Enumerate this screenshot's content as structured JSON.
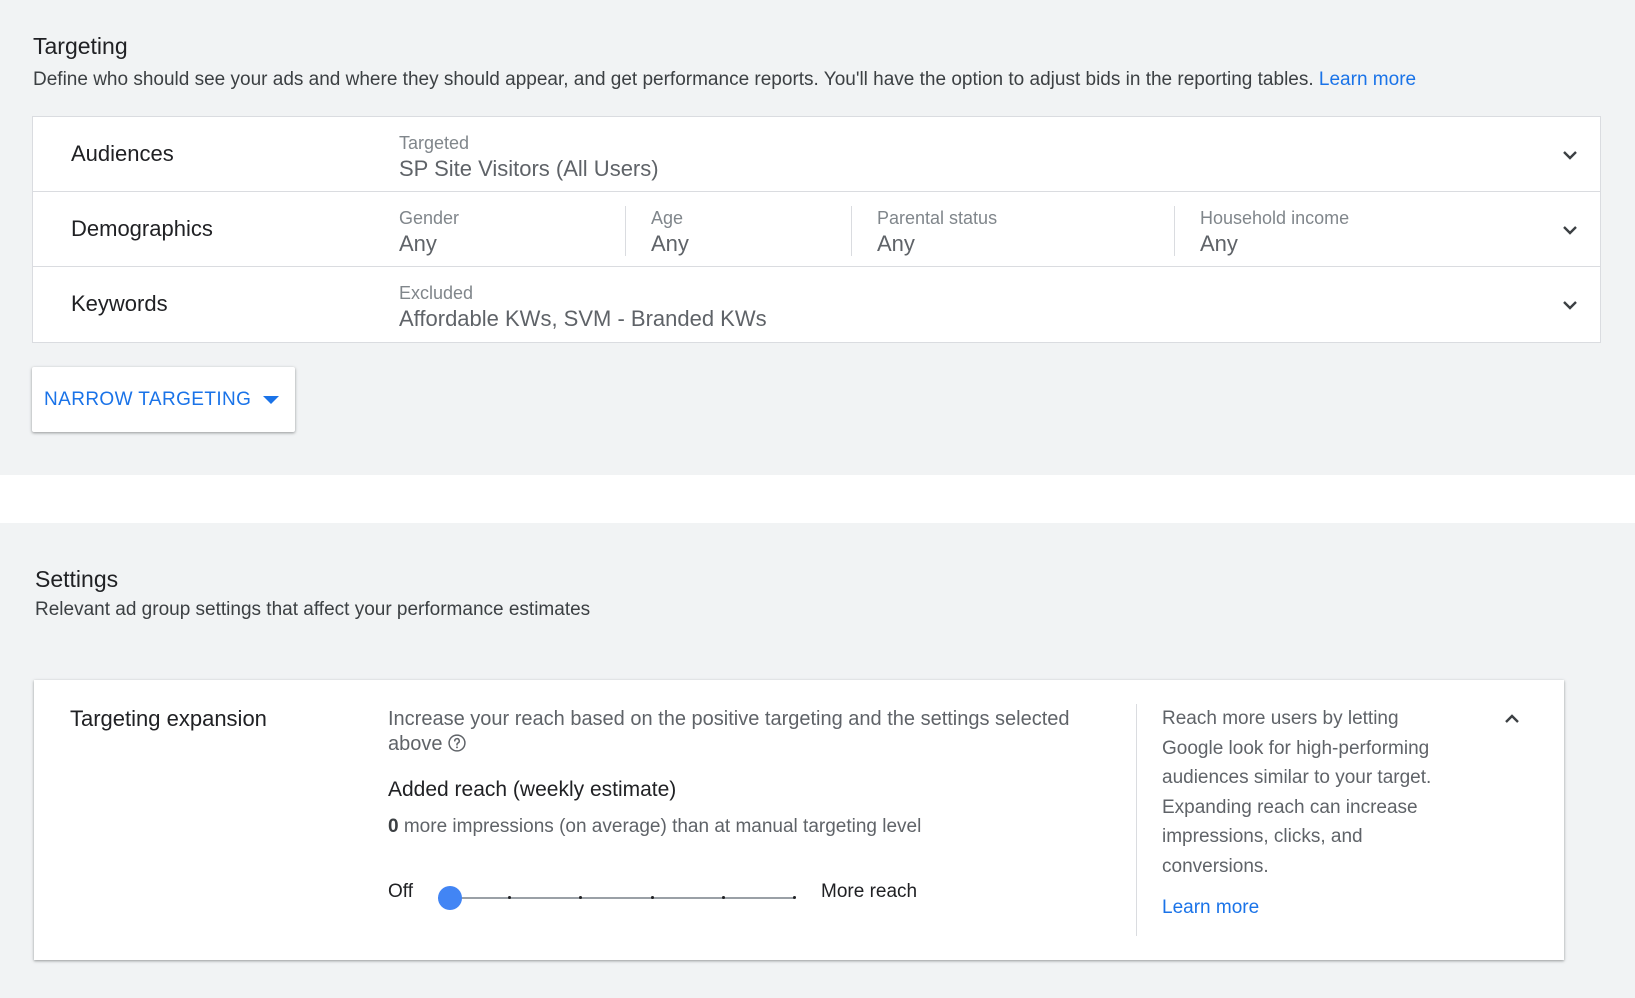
{
  "targeting": {
    "title": "Targeting",
    "description": "Define who should see your ads and where they should appear, and get performance reports. You'll have the option to adjust bids in the reporting tables.",
    "learn_more": "Learn more",
    "audiences": {
      "label": "Audiences",
      "field_label": "Targeted",
      "value": "SP Site Visitors (All Users)"
    },
    "demographics": {
      "label": "Demographics",
      "fields": [
        {
          "label": "Gender",
          "value": "Any"
        },
        {
          "label": "Age",
          "value": "Any"
        },
        {
          "label": "Parental status",
          "value": "Any"
        },
        {
          "label": "Household income",
          "value": "Any"
        }
      ]
    },
    "keywords": {
      "label": "Keywords",
      "field_label": "Excluded",
      "value": "Affordable KWs, SVM - Branded KWs"
    },
    "narrow_button": "NARROW TARGETING"
  },
  "settings": {
    "title": "Settings",
    "description": "Relevant ad group settings that affect your performance estimates",
    "expansion": {
      "label": "Targeting expansion",
      "intro": "Increase your reach based on the positive targeting and the settings selected above",
      "subheading": "Added reach (weekly estimate)",
      "impressions": "0",
      "impressions_suffix": " more impressions (on average) than at manual targeting level",
      "slider_min_label": "Off",
      "slider_max_label": "More reach",
      "slider_value": 0,
      "slider_steps": 6,
      "side_text": "Reach more users by letting Google look for high-performing audiences similar to your target. Expanding reach can increase impressions, clicks, and conversions.",
      "side_learn_more": "Learn more"
    }
  },
  "colors": {
    "accent": "#1a73e8",
    "slider_thumb": "#4285f4",
    "background": "#f1f3f4"
  }
}
